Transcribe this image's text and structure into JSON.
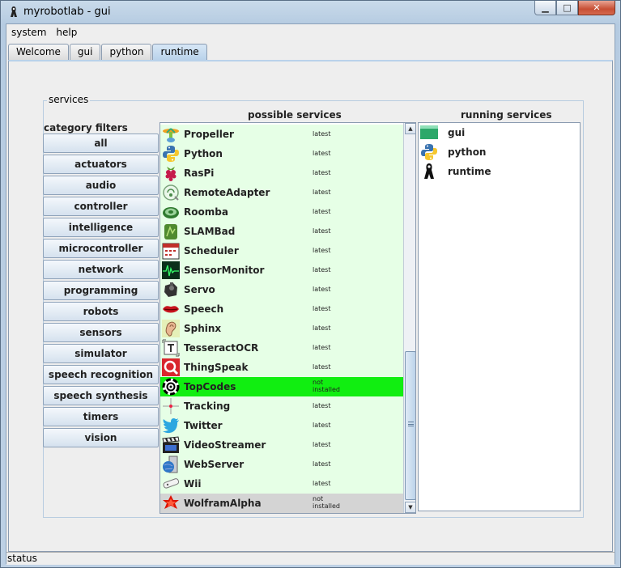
{
  "window": {
    "title": "myrobotlab - gui",
    "minimize_glyph": "▁",
    "maximize_glyph": "□",
    "close_glyph": "✕"
  },
  "menubar": {
    "items": [
      "system",
      "help"
    ]
  },
  "tabs": {
    "items": [
      "Welcome",
      "gui",
      "python",
      "runtime"
    ],
    "active": "runtime"
  },
  "services_group": {
    "title": "services",
    "category_filters_label": "category filters",
    "possible_label": "possible services",
    "running_label": "running services"
  },
  "categories": [
    "all",
    "actuators",
    "audio",
    "controller",
    "intelligence",
    "microcontroller",
    "network",
    "programming",
    "robots",
    "sensors",
    "simulator",
    "speech recognition",
    "speech synthesis",
    "timers",
    "vision"
  ],
  "possible_services": [
    {
      "name": "Propeller",
      "status": [
        "latest"
      ],
      "icon": "propeller-icon",
      "state": "installed"
    },
    {
      "name": "Python",
      "status": [
        "latest"
      ],
      "icon": "python-icon",
      "state": "installed"
    },
    {
      "name": "RasPi",
      "status": [
        "latest"
      ],
      "icon": "raspberry-icon",
      "state": "installed"
    },
    {
      "name": "RemoteAdapter",
      "status": [
        "latest"
      ],
      "icon": "remote-adapter-icon",
      "state": "installed"
    },
    {
      "name": "Roomba",
      "status": [
        "latest"
      ],
      "icon": "roomba-icon",
      "state": "installed"
    },
    {
      "name": "SLAMBad",
      "status": [
        "latest"
      ],
      "icon": "slam-icon",
      "state": "installed"
    },
    {
      "name": "Scheduler",
      "status": [
        "latest"
      ],
      "icon": "calendar-icon",
      "state": "installed"
    },
    {
      "name": "SensorMonitor",
      "status": [
        "latest"
      ],
      "icon": "oscilloscope-icon",
      "state": "installed"
    },
    {
      "name": "Servo",
      "status": [
        "latest"
      ],
      "icon": "servo-icon",
      "state": "installed"
    },
    {
      "name": "Speech",
      "status": [
        "latest"
      ],
      "icon": "lips-icon",
      "state": "installed"
    },
    {
      "name": "Sphinx",
      "status": [
        "latest"
      ],
      "icon": "ear-icon",
      "state": "installed"
    },
    {
      "name": "TesseractOCR",
      "status": [
        "latest"
      ],
      "icon": "ocr-icon",
      "state": "installed"
    },
    {
      "name": "ThingSpeak",
      "status": [
        "latest"
      ],
      "icon": "thingspeak-icon",
      "state": "installed"
    },
    {
      "name": "TopCodes",
      "status": [
        "not",
        "installed"
      ],
      "icon": "topcodes-icon",
      "state": "highlight"
    },
    {
      "name": "Tracking",
      "status": [
        "latest"
      ],
      "icon": "crosshair-icon",
      "state": "installed"
    },
    {
      "name": "Twitter",
      "status": [
        "latest"
      ],
      "icon": "twitter-bird-icon",
      "state": "installed"
    },
    {
      "name": "VideoStreamer",
      "status": [
        "latest"
      ],
      "icon": "clapperboard-icon",
      "state": "installed"
    },
    {
      "name": "WebServer",
      "status": [
        "latest"
      ],
      "icon": "webserver-icon",
      "state": "installed"
    },
    {
      "name": "Wii",
      "status": [
        "latest"
      ],
      "icon": "wii-remote-icon",
      "state": "installed"
    },
    {
      "name": "WolframAlpha",
      "status": [
        "not",
        "installed"
      ],
      "icon": "wolfram-icon",
      "state": "selected"
    }
  ],
  "running_services": [
    {
      "name": "gui",
      "icon": "gui-icon"
    },
    {
      "name": "python",
      "icon": "python-icon"
    },
    {
      "name": "runtime",
      "icon": "runtime-icon"
    }
  ],
  "status": {
    "label": "status"
  },
  "colors": {
    "installed_row": "#e6ffe6",
    "highlight_row": "#11ee11",
    "selected_row": "#d4d4d4"
  }
}
